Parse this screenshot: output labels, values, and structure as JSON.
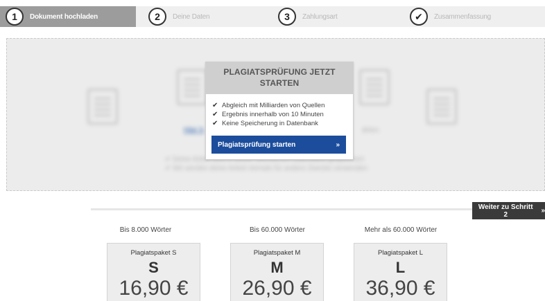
{
  "stepper": {
    "steps": [
      {
        "number": "1",
        "label": "Dokument hochladen"
      },
      {
        "number": "2",
        "label": "Deine Daten"
      },
      {
        "number": "3",
        "label": "Zahlungsart"
      },
      {
        "number": "✔",
        "label": "Zusammenfassung"
      }
    ]
  },
  "upload": {
    "link_text": "Hier k",
    "link_tail": "ählen",
    "note_1": "✔ Deine Arbeit wird in keiner öffentlichen Datenbank gespeichert",
    "note_2": "✔ Wir werden deine Arbeit niemals für andere Zwecke verwenden"
  },
  "popup": {
    "title_line1": "PLAGIATSPRÜFUNG JETZT",
    "title_line2": "STARTEN",
    "features": [
      "Abgleich mit Milliarden von Quellen",
      "Ergebnis innerhalb von 10 Minuten",
      "Keine Speicherung in Datenbank"
    ],
    "check_glyph": "✔",
    "button_label": "Plagiatsprüfung starten",
    "button_arrow": "»"
  },
  "next": {
    "label": "Weiter zu Schritt 2",
    "arrow": "»"
  },
  "pricing": {
    "tiers": [
      {
        "limit": "Bis 8.000 Wörter",
        "name": "Plagiatspaket S",
        "size": "S",
        "price": "16,90 €"
      },
      {
        "limit": "Bis 60.000 Wörter",
        "name": "Plagiatspaket M",
        "size": "M",
        "price": "26,90 €"
      },
      {
        "limit": "Mehr als 60.000 Wörter",
        "name": "Plagiatspaket L",
        "size": "L",
        "price": "36,90 €"
      }
    ]
  },
  "colors": {
    "active_step": "#9c9c9c",
    "primary_button": "#1b4d9c",
    "next_button": "#3a3a3a"
  }
}
